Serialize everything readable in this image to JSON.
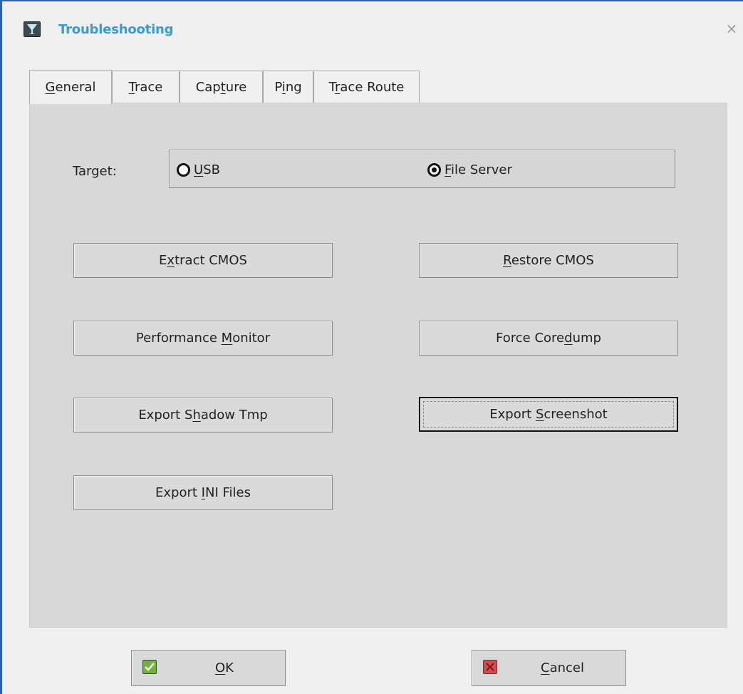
{
  "window": {
    "title": "Troubleshooting",
    "close_glyph": "×",
    "accent_color": "#2f63b5",
    "title_color": "#3a9bd0"
  },
  "tabs": [
    {
      "label_pre": "",
      "label_u": "G",
      "label_post": "eneral",
      "active": true
    },
    {
      "label_pre": "",
      "label_u": "T",
      "label_post": "race",
      "active": false
    },
    {
      "label_pre": "Cap",
      "label_u": "t",
      "label_post": "ure",
      "active": false
    },
    {
      "label_pre": "P",
      "label_u": "i",
      "label_post": "ng",
      "active": false
    },
    {
      "label_pre": "T",
      "label_u": "r",
      "label_post": "ace Route",
      "active": false
    }
  ],
  "target": {
    "label": "Target:",
    "options": [
      {
        "label_pre": "",
        "label_u": "U",
        "label_post": "SB",
        "checked": false
      },
      {
        "label_pre": "",
        "label_u": "F",
        "label_post": "ile Server",
        "checked": true
      }
    ]
  },
  "buttons": {
    "extract_cmos": {
      "pre": "E",
      "u": "x",
      "post": "tract CMOS"
    },
    "restore_cmos": {
      "pre": "",
      "u": "R",
      "post": "estore CMOS"
    },
    "performance_monitor": {
      "pre": "Performance ",
      "u": "M",
      "post": "onitor"
    },
    "force_coredump": {
      "pre": "Force Core",
      "u": "d",
      "post": "ump"
    },
    "export_shadow_tmp": {
      "pre": "Export S",
      "u": "h",
      "post": "adow Tmp"
    },
    "export_screenshot": {
      "pre": "Export ",
      "u": "S",
      "post": "creenshot"
    },
    "export_ini_files": {
      "pre": "Export ",
      "u": "I",
      "post": "NI Files"
    }
  },
  "dialog": {
    "ok": {
      "pre": "",
      "u": "O",
      "post": "K",
      "icon": "check-icon",
      "icon_color": "#6fb43a"
    },
    "cancel": {
      "pre": "",
      "u": "C",
      "post": "ancel",
      "icon": "cross-icon",
      "icon_color": "#d9484c"
    }
  }
}
